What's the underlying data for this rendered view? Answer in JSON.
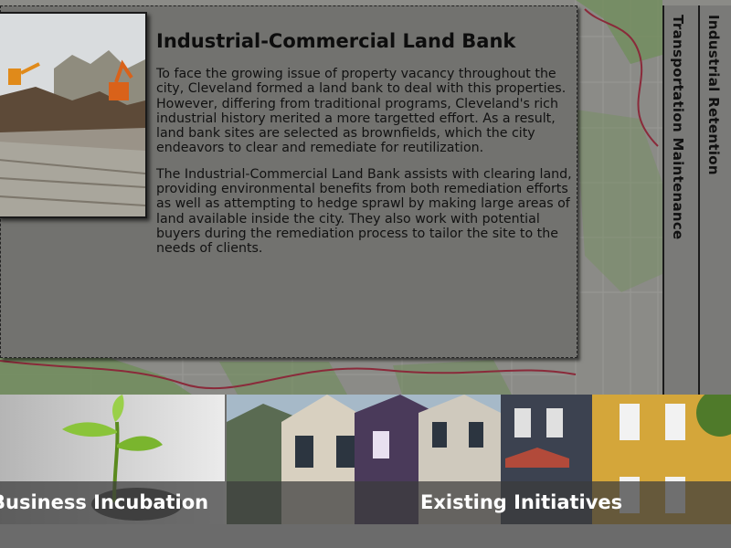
{
  "panel": {
    "title": "Industrial-Commercial Land Bank",
    "paragraph1": "To face the growing issue of property vacancy throughout the city, Cleveland formed a land bank to deal with this properties. However, differing from traditional programs, Cleveland's rich industrial history merited a more targetted effort. As a result, land bank sites are selected as brownfields, which the city endeavors to clear and remediate for reutilization.",
    "paragraph2": "The Industrial-Commercial Land Bank assists with clearing land, providing environmental benefits from both remediation efforts as well as attempting to hedge sprawl by making large areas of land available inside the city. They also work with potential buyers during the remediation process to tailor the site to the needs of clients."
  },
  "tabs": {
    "transportation": "Transportation Maintenance",
    "industrial": "Industrial Retention"
  },
  "tiles": {
    "business": "Business Incubation",
    "existing": "Existing Initiatives"
  },
  "colors": {
    "panel_bg": "#6e6e6c",
    "map_green": "#6f8d5a",
    "map_outline": "#8a2a3a",
    "caption_text": "#ffffff"
  }
}
